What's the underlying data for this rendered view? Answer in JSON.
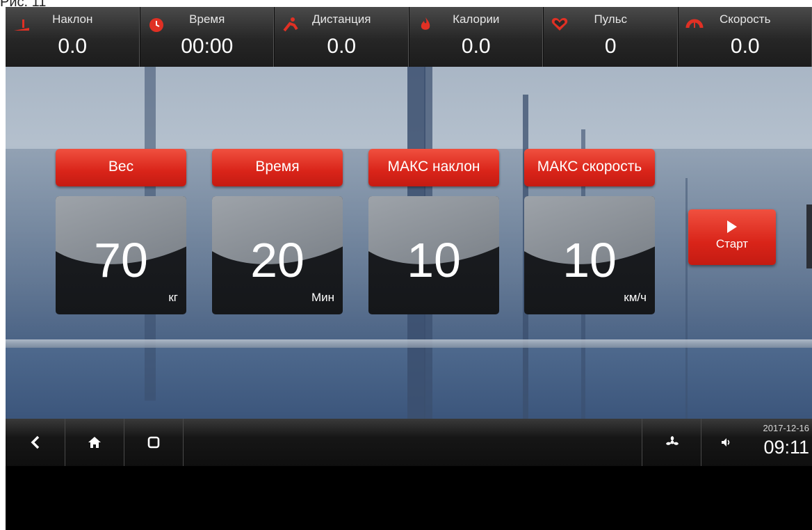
{
  "caption": "Рис. 11",
  "stats": [
    {
      "label": "Наклон",
      "value": "0.0",
      "icon": "incline-icon"
    },
    {
      "label": "Время",
      "value": "00:00",
      "icon": "clock-icon"
    },
    {
      "label": "Дистанция",
      "value": "0.0",
      "icon": "distance-icon"
    },
    {
      "label": "Калории",
      "value": "0.0",
      "icon": "flame-icon"
    },
    {
      "label": "Пульс",
      "value": "0",
      "icon": "heart-icon"
    },
    {
      "label": "Скорость",
      "value": "0.0",
      "icon": "speedometer-icon"
    }
  ],
  "settings": [
    {
      "label": "Вес",
      "value": "70",
      "unit": "кг"
    },
    {
      "label": "Время",
      "value": "20",
      "unit": "Мин"
    },
    {
      "label": "МАКС наклон",
      "value": "10",
      "unit": ""
    },
    {
      "label": "МАКС скорость",
      "value": "10",
      "unit": "км/ч"
    }
  ],
  "start": {
    "label": "Старт",
    "icon": "play-icon"
  },
  "navbar": {
    "back_icon": "back-icon",
    "home_icon": "home-icon",
    "recent_icon": "recent-apps-icon",
    "fan_icon": "fan-icon",
    "volume_icon": "volume-icon",
    "date": "2017-12-16",
    "time": "09:11"
  },
  "colors": {
    "accent_red": "#d92419",
    "top_bar": "#2a2a2a",
    "panel": "#16181b"
  }
}
